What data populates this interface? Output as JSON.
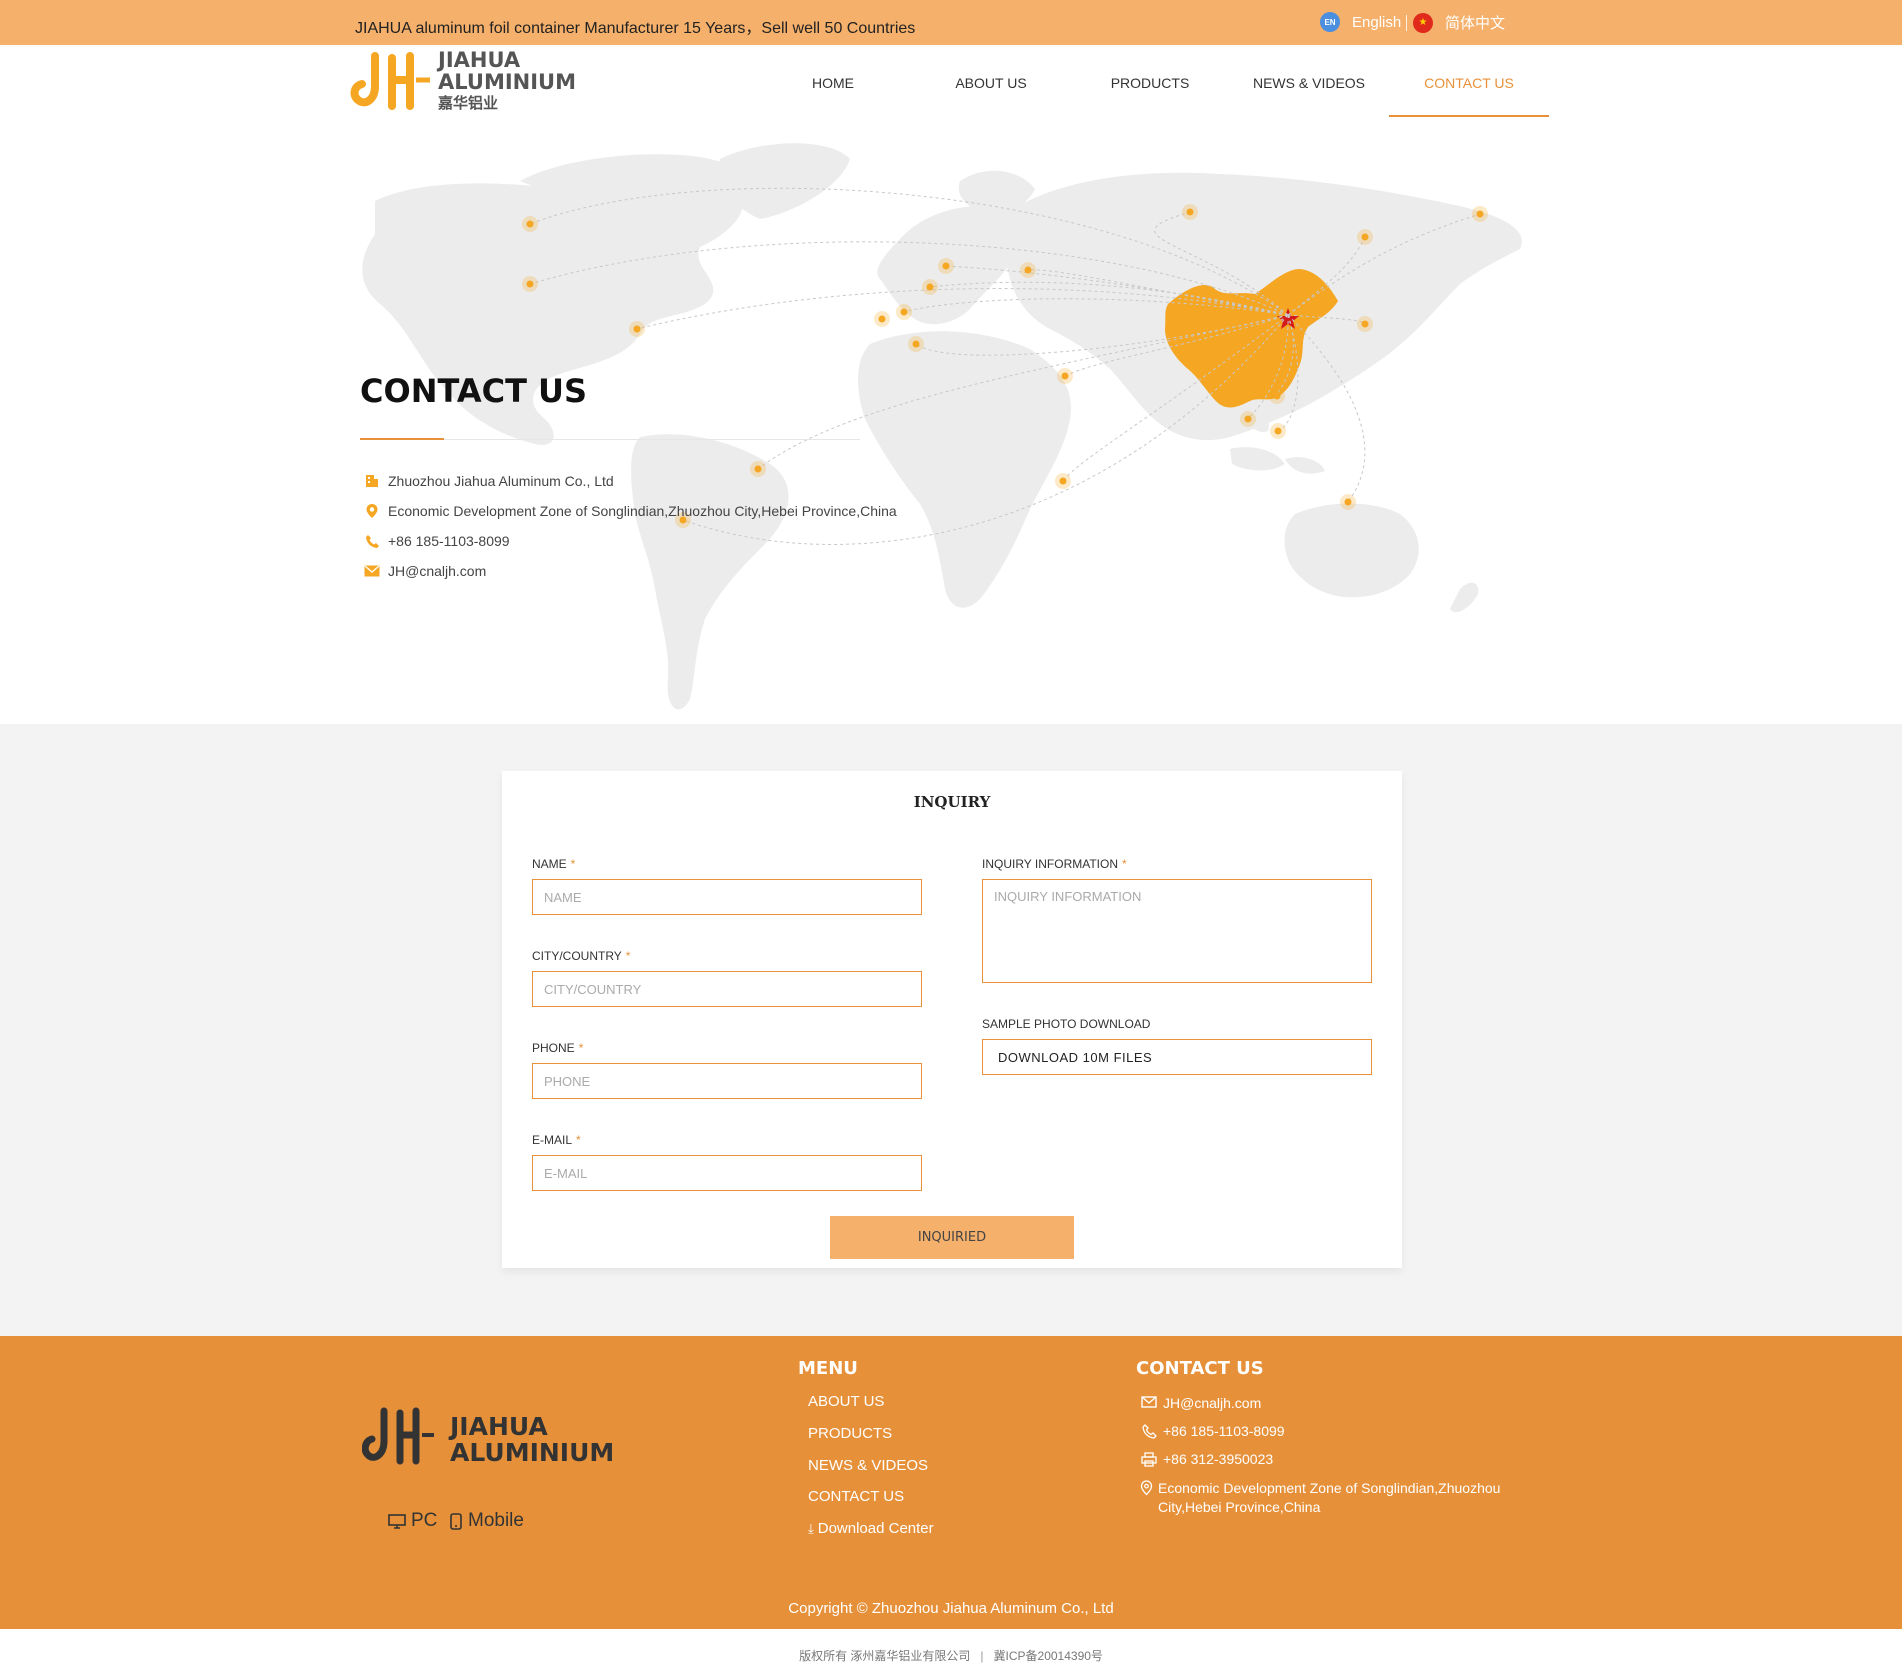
{
  "topbar": {
    "tagline": "JIAHUA aluminum foil container Manufacturer 15 Years，Sell well 50 Countries",
    "lang_en_badge": "EN",
    "lang_en": "English",
    "lang_cn": "简体中文"
  },
  "header": {
    "logo_line1": "JIAHUA",
    "logo_line2": "ALUMINIUM",
    "logo_line3": "嘉华铝业",
    "nav": [
      "HOME",
      "ABOUT US",
      "PRODUCTS",
      "NEWS & VIDEOS",
      "CONTACT US"
    ],
    "active_nav": "CONTACT US"
  },
  "hero": {
    "title": "CONTACT US",
    "company": "Zhuozhou Jiahua Aluminum Co., Ltd",
    "address": "Economic Development Zone of Songlindian,Zhuozhou City,Hebei Province,China",
    "phone": "+86 185-1103-8099",
    "email": "JH@cnaljh.com"
  },
  "inquiry": {
    "title": "INQUIRY",
    "name_label": "NAME",
    "name_placeholder": "NAME",
    "city_label": "CITY/COUNTRY",
    "city_placeholder": "CITY/COUNTRY",
    "phone_label": "PHONE",
    "phone_placeholder": "PHONE",
    "email_label": "E-MAIL",
    "email_placeholder": "E-MAIL",
    "info_label": "INQUIRY INFORMATION",
    "info_placeholder": "INQUIRY INFORMATION",
    "sample_label": "SAMPLE PHOTO DOWNLOAD",
    "download_button": "DOWNLOAD 10M FILES",
    "submit_button": "INQUIRIED",
    "required_mark": "*"
  },
  "footer": {
    "logo_line1": "JIAHUA",
    "logo_line2": "ALUMINIUM",
    "pc_label": "PC",
    "mobile_label": "Mobile",
    "menu_title": "MENU",
    "menu_items": [
      "ABOUT US",
      "PRODUCTS",
      "NEWS & VIDEOS",
      "CONTACT US",
      "Download Center"
    ],
    "contact_title": "CONTACT US",
    "email": "JH@cnaljh.com",
    "phone": "+86 185-1103-8099",
    "fax": "+86 312-3950023",
    "address": "Economic Development Zone of Songlindian,Zhuozhou City,Hebei Province,China",
    "copyright": "Copyright © Zhuozhou Jiahua Aluminum Co., Ltd"
  },
  "bottom": {
    "rights": "版权所有 涿州嘉华铝业有限公司",
    "separator": "|",
    "icp": "冀ICP备20014390号"
  },
  "colors": {
    "accent": "#e8913a",
    "topbar": "#f5b16b",
    "footer": "#e6913a",
    "map_land": "#ececec",
    "china": "#f5a623"
  }
}
